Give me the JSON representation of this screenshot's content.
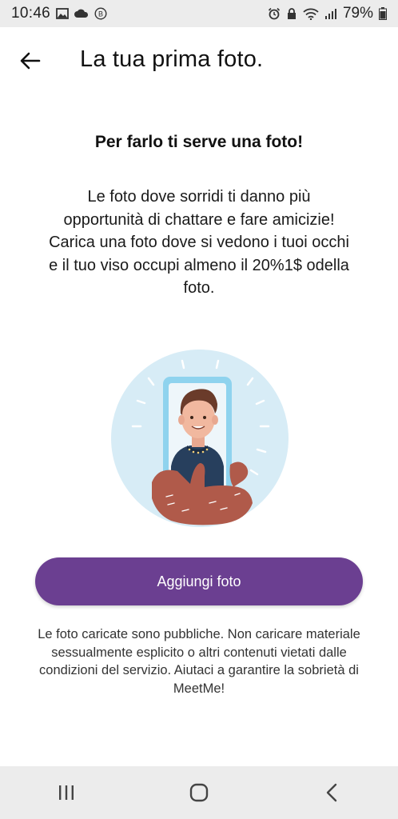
{
  "status_bar": {
    "time": "10:46",
    "battery_percent": "79%",
    "left_icons": [
      "image-icon",
      "cloud-icon",
      "b-badge-icon"
    ],
    "right_icons": [
      "alarm-icon",
      "lock-icon",
      "wifi-icon",
      "signal-icon",
      "battery-icon"
    ]
  },
  "header": {
    "title": "La tua prima foto.",
    "back_icon": "arrow-left-icon"
  },
  "main": {
    "heading": "Per farlo ti serve una foto!",
    "body": "Le foto dove sorridi ti danno più opportunità di chattare e fare amicizie! Carica una foto dove si vedono i tuoi occhi e il tuo viso occupi almeno il 20%1$ odella foto.",
    "illustration": "person-selfie-phone-illustration",
    "button_label": "Aggiungi foto",
    "disclaimer": "Le foto caricate sono pubbliche. Non caricare materiale sessualmente esplicito o altri contenuti vietati dalle condizioni del servizio. Aiutaci a garantire la sobrietà di MeetMe!"
  },
  "nav_bar": {
    "icons": [
      "recent-apps-icon",
      "home-icon",
      "back-icon"
    ]
  },
  "colors": {
    "accent": "#6b3f91",
    "illustration_bg": "#d7ecf6",
    "phone_frame": "#8fd3ee",
    "status_bar_bg": "#ececec"
  }
}
